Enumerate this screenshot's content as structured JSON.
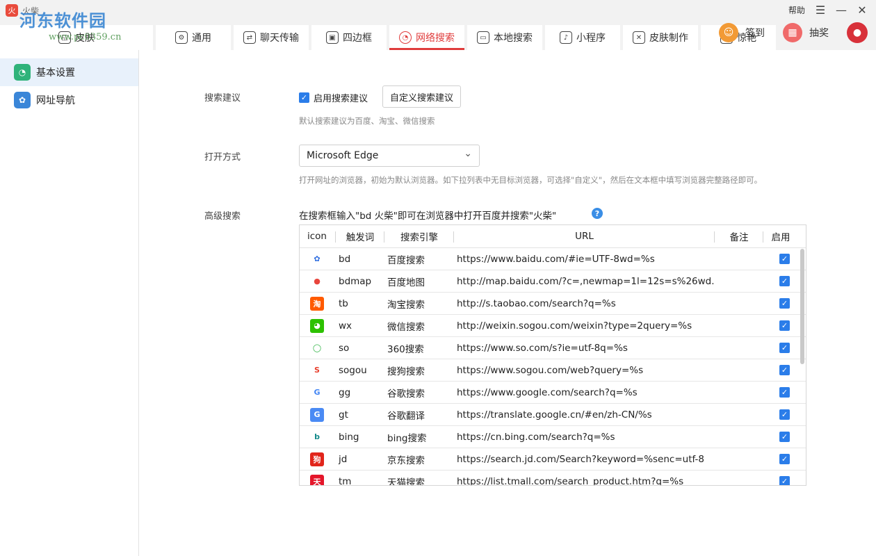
{
  "app": {
    "title": "火柴",
    "logo_glyph": "火"
  },
  "watermark": {
    "text": "河东软件园",
    "sub": "www.pc0359.cn"
  },
  "window": {
    "help_label": "帮助",
    "menu_glyph": "☰",
    "minimize_glyph": "—",
    "close_glyph": "✕"
  },
  "tabs": [
    {
      "label": "皮肤",
      "icon": "skin-icon",
      "glyph": "◱"
    },
    {
      "label": "通用",
      "icon": "general-icon",
      "glyph": "⚙"
    },
    {
      "label": "聊天传输",
      "icon": "chat-transfer-icon",
      "glyph": "⇄"
    },
    {
      "label": "四边框",
      "icon": "border-icon",
      "glyph": "▣"
    },
    {
      "label": "网络搜索",
      "icon": "web-search-icon",
      "glyph": "◔",
      "active": true
    },
    {
      "label": "本地搜索",
      "icon": "monitor-icon",
      "glyph": "▭"
    },
    {
      "label": "小程序",
      "icon": "mini-program-icon",
      "glyph": "♪"
    },
    {
      "label": "皮肤制作",
      "icon": "skin-maker-icon",
      "glyph": "✕"
    },
    {
      "label": "惊艳",
      "icon": "target-icon",
      "glyph": "◎"
    }
  ],
  "actions": {
    "signin_label": "签到",
    "signin_icon": "coin-icon",
    "signin_glyph": "☺",
    "signin_color": "#f29a35",
    "lottery_label": "抽奖",
    "lottery_icon": "gift-icon",
    "lottery_glyph": "▦",
    "lottery_color": "#f06a6a",
    "avatar_glyph": "●",
    "avatar_color": "#d8313a"
  },
  "sidebar": {
    "items": [
      {
        "label": "基本设置",
        "icon": "settings-icon",
        "glyph": "◔",
        "color": "#2fb37a",
        "active": true
      },
      {
        "label": "网址导航",
        "icon": "nav-icon",
        "glyph": "✿",
        "color": "#3a86d8"
      }
    ]
  },
  "search_suggest": {
    "label": "搜索建议",
    "checkbox_label": "启用搜索建议",
    "checked_glyph": "✓",
    "custom_button": "自定义搜索建议",
    "hint": "默认搜索建议为百度、淘宝、微信搜索"
  },
  "open_mode": {
    "label": "打开方式",
    "selected": "Microsoft Edge",
    "chevron": "⌄",
    "hint": "打开网址的浏览器，初始为默认浏览器。如下拉列表中无目标浏览器，可选择\"自定义\"，然后在文本框中填写浏览器完整路径即可。"
  },
  "advanced": {
    "label": "高级搜索",
    "description": "在搜索框输入\"bd 火柴\"即可在浏览器中打开百度并搜索\"火柴\"",
    "help_glyph": "?"
  },
  "table": {
    "headers": {
      "icon": "icon",
      "trigger": "触发词",
      "engine": "搜索引擎",
      "url": "URL",
      "note": "备注",
      "enabled": "启用"
    },
    "rows": [
      {
        "icon": "baidu-icon",
        "glyph": "✿",
        "color": "#ffffff",
        "fg": "#2f6ee0",
        "trigger": "bd",
        "engine": "百度搜索",
        "url": "https://www.baidu.com/#ie=UTF-8wd=%s",
        "note": "",
        "enabled": true
      },
      {
        "icon": "baidu-map-icon",
        "glyph": "●",
        "color": "#ffffff",
        "fg": "#e8453c",
        "trigger": "bdmap",
        "engine": "百度地图",
        "url": "http://map.baidu.com/?c=,newmap=1l=12s=s%26wd...",
        "note": "",
        "enabled": true
      },
      {
        "icon": "taobao-icon",
        "glyph": "淘",
        "color": "#ff5a00",
        "fg": "#ffffff",
        "trigger": "tb",
        "engine": "淘宝搜索",
        "url": "http://s.taobao.com/search?q=%s",
        "note": "",
        "enabled": true
      },
      {
        "icon": "wechat-icon",
        "glyph": "◕",
        "color": "#2dc100",
        "fg": "#ffffff",
        "trigger": "wx",
        "engine": "微信搜索",
        "url": "http://weixin.sogou.com/weixin?type=2query=%s",
        "note": "",
        "enabled": true
      },
      {
        "icon": "so360-icon",
        "glyph": "◯",
        "color": "#ffffff",
        "fg": "#2fb344",
        "trigger": "so",
        "engine": "360搜索",
        "url": "https://www.so.com/s?ie=utf-8q=%s",
        "note": "",
        "enabled": true
      },
      {
        "icon": "sogou-icon",
        "glyph": "S",
        "color": "#ffffff",
        "fg": "#e8402e",
        "trigger": "sogou",
        "engine": "搜狗搜索",
        "url": "https://www.sogou.com/web?query=%s",
        "note": "",
        "enabled": true
      },
      {
        "icon": "google-icon",
        "glyph": "G",
        "color": "#ffffff",
        "fg": "#4285f4",
        "trigger": "gg",
        "engine": "谷歌搜索",
        "url": "https://www.google.com/search?q=%s",
        "note": "",
        "enabled": true
      },
      {
        "icon": "google-translate-icon",
        "glyph": "G",
        "color": "#4a8af4",
        "fg": "#ffffff",
        "trigger": "gt",
        "engine": "谷歌翻译",
        "url": "https://translate.google.cn/#en/zh-CN/%s",
        "note": "",
        "enabled": true
      },
      {
        "icon": "bing-icon",
        "glyph": "b",
        "color": "#ffffff",
        "fg": "#138a8a",
        "trigger": "bing",
        "engine": "bing搜索",
        "url": "https://cn.bing.com/search?q=%s",
        "note": "",
        "enabled": true
      },
      {
        "icon": "jd-icon",
        "glyph": "狗",
        "color": "#e1251b",
        "fg": "#ffffff",
        "trigger": "jd",
        "engine": "京东搜索",
        "url": "https://search.jd.com/Search?keyword=%senc=utf-8",
        "note": "",
        "enabled": true
      },
      {
        "icon": "tmall-icon",
        "glyph": "天",
        "color": "#e4162a",
        "fg": "#ffffff",
        "trigger": "tm",
        "engine": "天猫搜索",
        "url": "https://list.tmall.com/search_product.htm?q=%s",
        "note": "",
        "enabled": true
      }
    ]
  }
}
